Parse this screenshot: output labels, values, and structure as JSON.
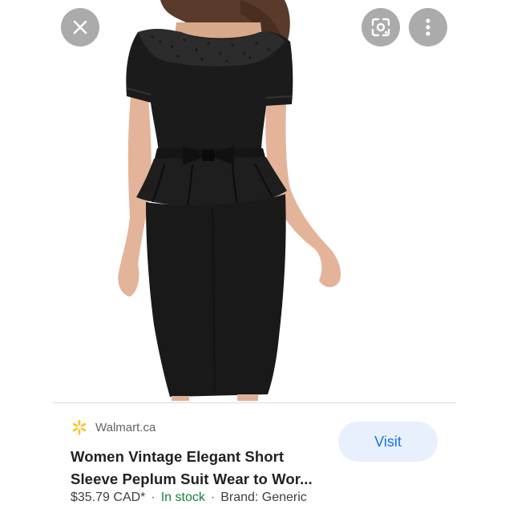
{
  "viewer": {
    "close_icon": "close-icon",
    "lens_icon": "google-lens-icon",
    "more_icon": "more-vert-icon"
  },
  "image": {
    "subject": "product-photo-black-peplum-dress"
  },
  "result": {
    "source_icon": "walmart-spark-icon",
    "source_name": "Walmart.ca",
    "title_line1": "Women Vintage Elegant Short",
    "title_line2": "Sleeve Peplum Suit Wear to Wor...",
    "price": "$35.79 CAD*",
    "separator": "·",
    "stock": "In stock",
    "brand": "Brand: Generic",
    "visit_label": "Visit"
  },
  "colors": {
    "visit_bg": "#e8f0fe",
    "visit_text": "#1a73e8",
    "in_stock": "#188038",
    "walmart_spark": "#ffc220"
  }
}
